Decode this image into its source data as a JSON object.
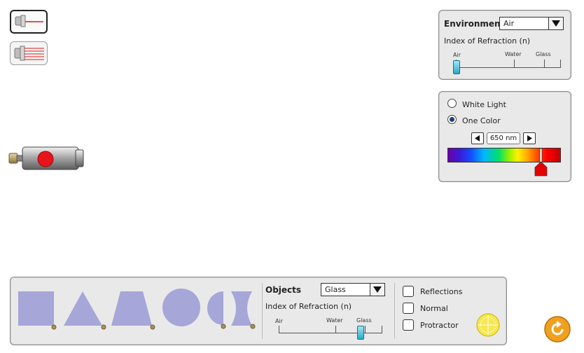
{
  "laser_modes": [
    {
      "name": "ray",
      "selected": true
    },
    {
      "name": "wave",
      "selected": false
    }
  ],
  "environment": {
    "title": "Environment",
    "selected": "Air",
    "index_label": "Index of Refraction (n)",
    "slider_labels": {
      "air": "Air",
      "water": "Water",
      "glass": "Glass"
    },
    "slider_value_fraction": 0.0
  },
  "light_panel": {
    "white_light_label": "White Light",
    "one_color_label": "One Color",
    "selected_option": "One Color",
    "wavelength_text": "650 nm",
    "wavelength_slider_fraction": 0.83
  },
  "laser": {
    "color": "#e8141b"
  },
  "objects": {
    "title": "Objects",
    "selected": "Glass",
    "index_label": "Index of Refraction (n)",
    "slider_labels": {
      "air": "Air",
      "water": "Water",
      "glass": "Glass"
    },
    "slider_value_fraction": 0.8,
    "shapes": [
      "rectangle",
      "triangle",
      "trapezoid",
      "circle",
      "semicircle",
      "diverging-lens"
    ],
    "shape_color": "#a6a6d8"
  },
  "options": {
    "reflections_label": "Reflections",
    "normal_label": "Normal",
    "protractor_label": "Protractor",
    "reflections_checked": false,
    "normal_checked": false,
    "protractor_checked": false
  },
  "reset": {
    "icon": "reset-icon",
    "color": "#f0a020"
  }
}
